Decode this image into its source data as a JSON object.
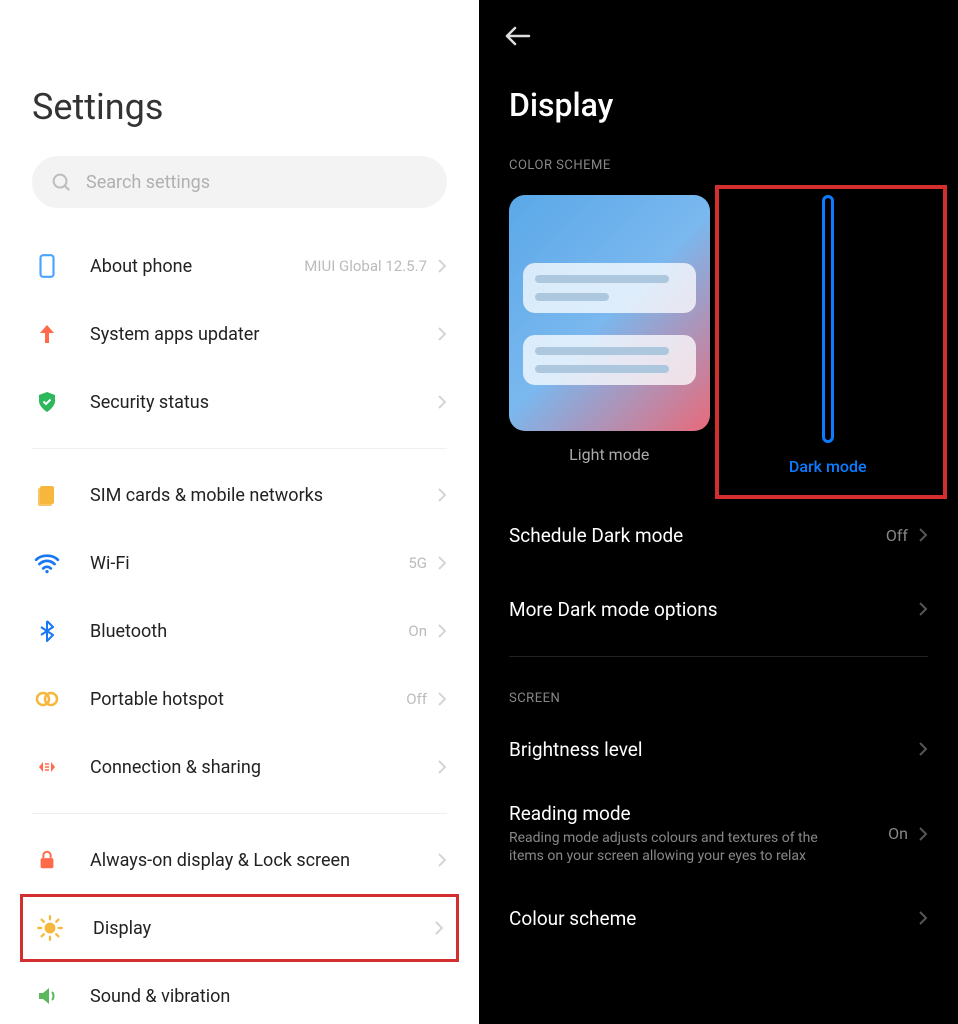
{
  "left": {
    "title": "Settings",
    "search_placeholder": "Search settings",
    "items": [
      {
        "label": "About phone",
        "value": "MIUI Global 12.5.7",
        "icon": "phone"
      },
      {
        "label": "System apps updater",
        "value": "",
        "icon": "updater"
      },
      {
        "label": "Security status",
        "value": "",
        "icon": "security"
      }
    ],
    "items2": [
      {
        "label": "SIM cards & mobile networks",
        "value": "",
        "icon": "sim"
      },
      {
        "label": "Wi-Fi",
        "value": "5G",
        "icon": "wifi"
      },
      {
        "label": "Bluetooth",
        "value": "On",
        "icon": "bluetooth"
      },
      {
        "label": "Portable hotspot",
        "value": "Off",
        "icon": "hotspot"
      },
      {
        "label": "Connection & sharing",
        "value": "",
        "icon": "connection"
      }
    ],
    "items3": [
      {
        "label": "Always-on display & Lock screen",
        "value": "",
        "icon": "lock"
      },
      {
        "label": "Display",
        "value": "",
        "icon": "display",
        "highlighted": true
      },
      {
        "label": "Sound & vibration",
        "value": "",
        "icon": "sound"
      }
    ]
  },
  "right": {
    "title": "Display",
    "section_color_scheme": "COLOR SCHEME",
    "light_mode_label": "Light mode",
    "dark_mode_label": "Dark mode",
    "selected_mode": "dark",
    "schedule_label": "Schedule Dark mode",
    "schedule_value": "Off",
    "more_options_label": "More Dark mode options",
    "section_screen": "SCREEN",
    "brightness_label": "Brightness level",
    "reading_label": "Reading mode",
    "reading_sub": "Reading mode adjusts colours and textures of the items on your screen allowing your eyes to relax",
    "reading_value": "On",
    "colour_scheme_label": "Colour scheme"
  }
}
